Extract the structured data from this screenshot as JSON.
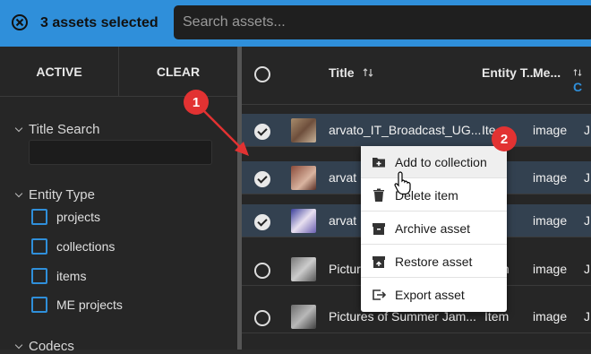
{
  "topbar": {
    "selection_text": "3 assets selected",
    "search_placeholder": "Search assets..."
  },
  "sidebar": {
    "active_label": "ACTIVE",
    "clear_label": "CLEAR",
    "title_search_label": "Title Search",
    "entity_type_label": "Entity Type",
    "entity_types": [
      "projects",
      "collections",
      "items",
      "ME projects"
    ],
    "codecs_label": "Codecs"
  },
  "table": {
    "headers": {
      "title": "Title",
      "entity_type": "Entity T...",
      "media": "Me...",
      "extra": "C"
    },
    "rows": [
      {
        "title": "arvato_IT_Broadcast_UG...",
        "entity": "Ite",
        "media": "image",
        "extra": "J",
        "selected": true
      },
      {
        "title": "arvat",
        "entity": "",
        "media": "image",
        "extra": "J",
        "selected": true
      },
      {
        "title": "arvat",
        "entity": "",
        "media": "image",
        "extra": "J",
        "selected": true
      },
      {
        "title": "Pictur",
        "entity": "m",
        "media": "image",
        "extra": "J",
        "selected": false
      },
      {
        "title": "Pictures of Summer Jam...",
        "entity": "Item",
        "media": "image",
        "extra": "J",
        "selected": false
      }
    ]
  },
  "context_menu": {
    "items": [
      {
        "label": "Add to collection",
        "icon": "folder-plus-icon"
      },
      {
        "label": "Delete item",
        "icon": "trash-icon"
      },
      {
        "label": "Archive asset",
        "icon": "archive-icon"
      },
      {
        "label": "Restore asset",
        "icon": "restore-icon"
      },
      {
        "label": "Export asset",
        "icon": "export-icon"
      }
    ]
  },
  "annotations": {
    "badge1": "1",
    "badge2": "2"
  },
  "colors": {
    "accent": "#2f8fda",
    "selected_row": "#334150",
    "badge": "#e23232"
  }
}
